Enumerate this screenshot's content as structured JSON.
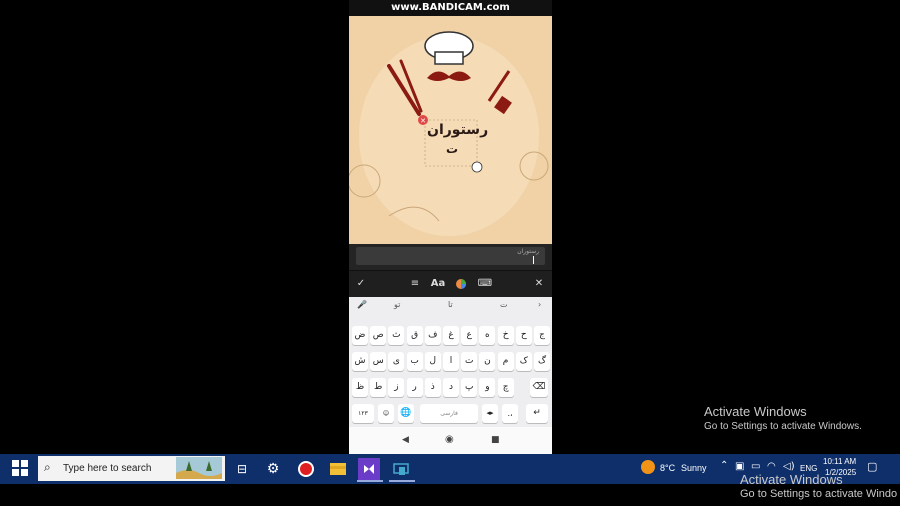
{
  "recorder_watermark": "www.BANDICAM.com",
  "editor": {
    "canvas_text_line1": "رستوران",
    "canvas_text_line2": "ت",
    "input_value": "رستوران"
  },
  "toolbar": {
    "align_icon": "align-icon",
    "font_label": "Aa",
    "color_icon": "color-wheel-icon",
    "keyboard_icon": "keyboard-icon"
  },
  "keyboard": {
    "suggestions": [
      "تو",
      "تا",
      "ت"
    ],
    "row1": [
      "ض",
      "ص",
      "ث",
      "ق",
      "ف",
      "غ",
      "ع",
      "ه",
      "خ",
      "ح",
      "ج"
    ],
    "row2": [
      "ش",
      "س",
      "ی",
      "ب",
      "ل",
      "ا",
      "ت",
      "ن",
      "م",
      "ک",
      "گ"
    ],
    "row3": [
      "ظ",
      "ط",
      "ز",
      "ر",
      "ذ",
      "د",
      "پ",
      "و",
      "چ"
    ],
    "numbers_label": "۱۲۳",
    "space_label": "فارسی",
    "punct_label": ".،"
  },
  "taskbar": {
    "search_placeholder": "Type here to search",
    "weather_temp": "8°C",
    "weather_desc": "Sunny",
    "language": "ENG",
    "time": "10:11 AM",
    "date": "1/2/2025"
  },
  "watermark": {
    "title": "Activate Windows",
    "subtitle": "Go to Settings to activate Windows.",
    "title2": "Activate Windows",
    "subtitle2": "Go to Settings to activate Windo"
  }
}
